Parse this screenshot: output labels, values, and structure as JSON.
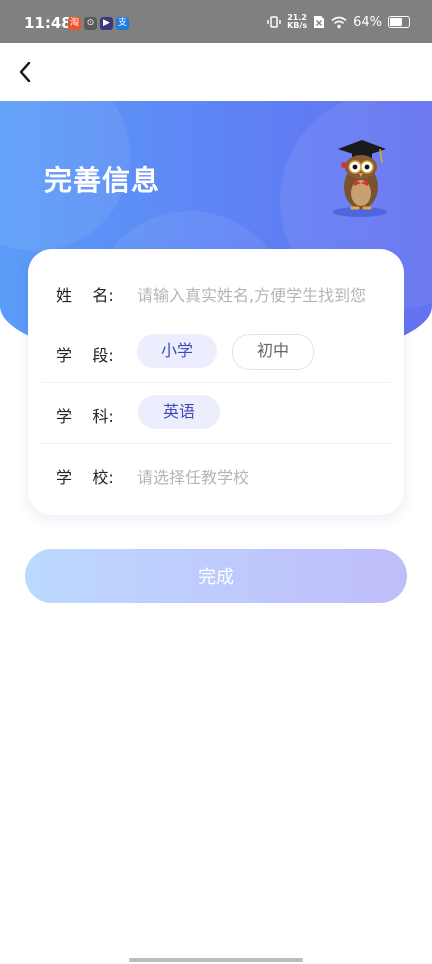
{
  "status_bar": {
    "time": "11:48",
    "network_speed_value": "21.2",
    "network_speed_unit": "KB/s",
    "battery": "64%",
    "app_icons": [
      "淘",
      "⊙",
      "▶",
      "支"
    ]
  },
  "nav": {
    "back_icon": "chevron-left-icon"
  },
  "header": {
    "title": "完善信息"
  },
  "form": {
    "name": {
      "label": "姓    名:",
      "placeholder": "请输入真实姓名,方便学生找到您"
    },
    "stage": {
      "label": "学    段:",
      "options": [
        "小学",
        "初中"
      ],
      "selected": "小学"
    },
    "subject": {
      "label": "学    科:",
      "options": [
        "英语"
      ],
      "selected": "英语"
    },
    "school": {
      "label": "学    校:",
      "placeholder": "请选择任教学校"
    }
  },
  "actions": {
    "done_label": "完成"
  },
  "colors": {
    "primary_gradient_start": "#5a9df8",
    "primary_gradient_end": "#6571f0",
    "chip_selected_bg": "#eceefd",
    "chip_selected_text": "#3f4bb8"
  }
}
